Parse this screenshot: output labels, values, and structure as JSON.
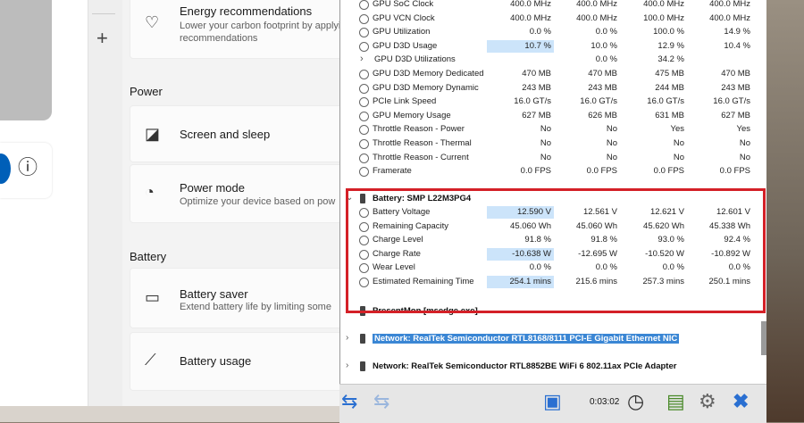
{
  "settings": {
    "energy": {
      "title": "Energy recommendations",
      "desc_line1": "Lower your carbon footprint by applying",
      "desc_line2": "recommendations"
    },
    "power_section": "Power",
    "screen_sleep": {
      "title": "Screen and sleep"
    },
    "power_mode": {
      "title": "Power mode",
      "desc": "Optimize your device based on pow"
    },
    "battery_section": "Battery",
    "battery_saver": {
      "title": "Battery saver",
      "desc": "Extend battery life by limiting some"
    },
    "battery_usage": {
      "title": "Battery usage"
    }
  },
  "hwinfo": {
    "rows_top": [
      {
        "name": "GPU SoC Clock",
        "v": [
          "400.0 MHz",
          "400.0 MHz",
          "400.0 MHz",
          "400.0 MHz"
        ]
      },
      {
        "name": "GPU VCN Clock",
        "v": [
          "400.0 MHz",
          "400.0 MHz",
          "100.0 MHz",
          "400.0 MHz"
        ]
      },
      {
        "name": "GPU Utilization",
        "v": [
          "0.0 %",
          "0.0 %",
          "100.0 %",
          "14.9 %"
        ]
      },
      {
        "name": "GPU D3D Usage",
        "v": [
          "10.7 %",
          "10.0 %",
          "12.9 %",
          "10.4 %"
        ]
      },
      {
        "name": "GPU D3D Utilizations",
        "v": [
          "",
          "0.0 %",
          "34.2 %",
          ""
        ]
      },
      {
        "name": "GPU D3D Memory Dedicated",
        "v": [
          "470 MB",
          "470 MB",
          "475 MB",
          "470 MB"
        ]
      },
      {
        "name": "GPU D3D Memory Dynamic",
        "v": [
          "243 MB",
          "243 MB",
          "244 MB",
          "243 MB"
        ]
      },
      {
        "name": "PCIe Link Speed",
        "v": [
          "16.0 GT/s",
          "16.0 GT/s",
          "16.0 GT/s",
          "16.0 GT/s"
        ]
      },
      {
        "name": "GPU Memory Usage",
        "v": [
          "627 MB",
          "626 MB",
          "631 MB",
          "627 MB"
        ]
      },
      {
        "name": "Throttle Reason - Power",
        "v": [
          "No",
          "No",
          "Yes",
          "Yes"
        ]
      },
      {
        "name": "Throttle Reason - Thermal",
        "v": [
          "No",
          "No",
          "No",
          "No"
        ]
      },
      {
        "name": "Throttle Reason - Current",
        "v": [
          "No",
          "No",
          "No",
          "No"
        ]
      },
      {
        "name": "Framerate",
        "v": [
          "0.0 FPS",
          "0.0 FPS",
          "0.0 FPS",
          "0.0 FPS"
        ]
      }
    ],
    "battery_group": "Battery: SMP L22M3PG4",
    "rows_battery": [
      {
        "name": "Battery Voltage",
        "v": [
          "12.590 V",
          "12.561 V",
          "12.621 V",
          "12.601 V"
        ]
      },
      {
        "name": "Remaining Capacity",
        "v": [
          "45.060 Wh",
          "45.060 Wh",
          "45.620 Wh",
          "45.338 Wh"
        ]
      },
      {
        "name": "Charge Level",
        "v": [
          "91.8 %",
          "91.8 %",
          "93.0 %",
          "92.4 %"
        ]
      },
      {
        "name": "Charge Rate",
        "v": [
          "-10.638 W",
          "-12.695 W",
          "-10.520 W",
          "-10.892 W"
        ]
      },
      {
        "name": "Wear Level",
        "v": [
          "0.0 %",
          "0.0 %",
          "0.0 %",
          "0.0 %"
        ]
      },
      {
        "name": "Estimated Remaining Time",
        "v": [
          "254.1 mins",
          "215.6 mins",
          "257.3 mins",
          "250.1 mins"
        ]
      }
    ],
    "presentmon_group": "PresentMon [msedge.exe]",
    "network1": "Network: RealTek Semiconductor RTL8168/8111 PCI-E Gigabit Ethernet NIC",
    "network2": "Network: RealTek Semiconductor RTL8852BE WiFi 6 802.11ax PCIe Adapter",
    "timer": "0:03:02"
  },
  "colors": {
    "highlight": "#cce4fa",
    "redbox": "#d42027",
    "selection": "#3a86d4"
  }
}
